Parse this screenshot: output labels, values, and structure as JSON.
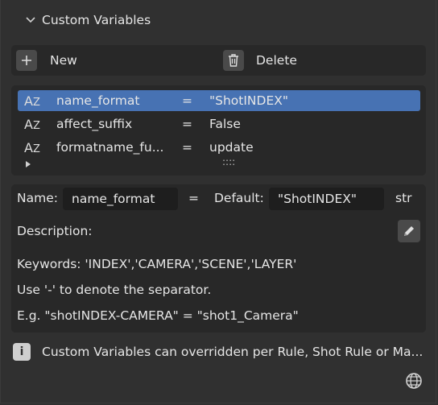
{
  "panel": {
    "title": "Custom Variables"
  },
  "toolbar": {
    "new_label": "New",
    "delete_label": "Delete"
  },
  "list": {
    "items": [
      {
        "name": "name_format",
        "eq": "=",
        "value": "\"ShotINDEX\"",
        "selected": true
      },
      {
        "name": "affect_suffix",
        "eq": "=",
        "value": "False",
        "selected": false
      },
      {
        "name": "formatname_fu...",
        "eq": "=",
        "value": "update",
        "selected": false
      }
    ],
    "grip": "::::"
  },
  "editor": {
    "name_label": "Name:",
    "name_value": "name_format",
    "eq": "=",
    "default_label": "Default:",
    "default_value": "\"ShotINDEX\"",
    "type": "str",
    "description_label": "Description:",
    "keywords_line": "Keywords: 'INDEX','CAMERA','SCENE','LAYER'",
    "separator_line": "Use '-' to denote the separator.",
    "example_line": "E.g. \"shotINDEX-CAMERA\" = \"shot1_Camera\""
  },
  "info": {
    "text": "Custom Variables can overridden per Rule, Shot Rule or Ma..."
  },
  "colors": {
    "accent": "#4772b3",
    "background": "#303030",
    "box": "#282828",
    "field": "#1e1e1e"
  }
}
